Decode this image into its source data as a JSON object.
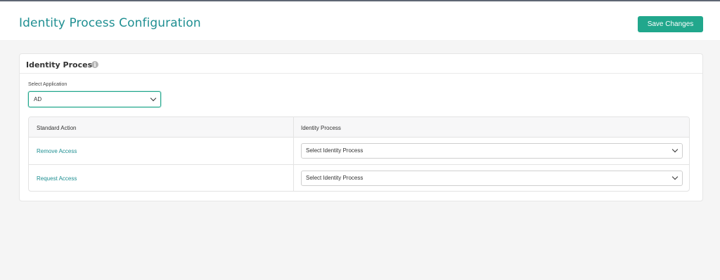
{
  "header": {
    "title": "Identity Process Configuration",
    "save_label": "Save Changes"
  },
  "card": {
    "title": "Identity Process",
    "info_icon": "info-icon",
    "select_application": {
      "label": "Select Application",
      "value": "AD"
    },
    "table": {
      "columns": [
        "Standard Action",
        "Identity Process"
      ],
      "rows": [
        {
          "action": "Remove Access",
          "process_value": "Select Identity Process"
        },
        {
          "action": "Request Access",
          "process_value": "Select Identity Process"
        }
      ]
    }
  },
  "colors": {
    "accent": "#21a78c",
    "title_teal": "#1f8f92",
    "background": "#f5f5f5"
  }
}
